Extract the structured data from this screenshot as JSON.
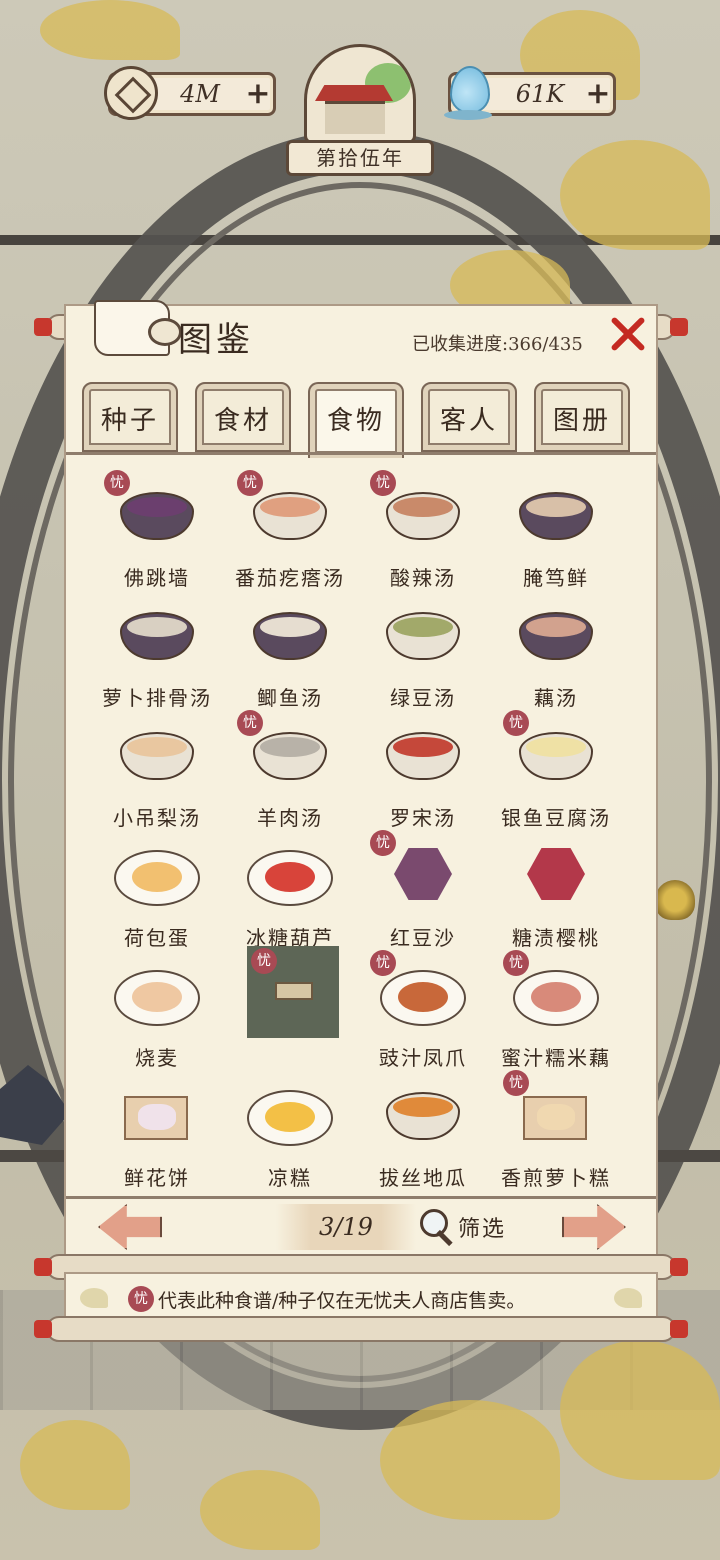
{
  "currencies": {
    "coins": {
      "icon": "coin-icon",
      "value": "4M",
      "plus": "+"
    },
    "water": {
      "icon": "water-drop-icon",
      "value": "61K",
      "plus": "+"
    }
  },
  "year_banner": "第拾伍年",
  "panel": {
    "title": "图鉴",
    "progress": "已收集进度:366/435",
    "close_icon": "close-icon"
  },
  "tabs": [
    {
      "label": "种子",
      "active": false
    },
    {
      "label": "食材",
      "active": false
    },
    {
      "label": "食物",
      "active": true
    },
    {
      "label": "客人",
      "active": false
    },
    {
      "label": "图册",
      "active": false
    }
  ],
  "shop_tag": "忧",
  "items": [
    {
      "name": "佛跳墙",
      "shop_only": true,
      "icon": "clay-pot-dish-icon",
      "color": "#6b3f6e"
    },
    {
      "name": "番茄疙瘩汤",
      "shop_only": true,
      "icon": "tomato-soup-bowl-icon",
      "color": "#e0a080"
    },
    {
      "name": "酸辣汤",
      "shop_only": true,
      "icon": "hot-sour-soup-bowl-icon",
      "color": "#c98a6a"
    },
    {
      "name": "腌笃鲜",
      "shop_only": false,
      "icon": "clay-pot-dish-icon",
      "color": "#d8c0a8"
    },
    {
      "name": "萝卜排骨汤",
      "shop_only": false,
      "icon": "clay-pot-dish-icon",
      "color": "#d9d0c2"
    },
    {
      "name": "鲫鱼汤",
      "shop_only": false,
      "icon": "clay-pot-dish-icon",
      "color": "#e6ddd0"
    },
    {
      "name": "绿豆汤",
      "shop_only": false,
      "icon": "mung-bean-soup-bowl-icon",
      "color": "#a2a96a"
    },
    {
      "name": "藕汤",
      "shop_only": false,
      "icon": "clay-pot-dish-icon",
      "color": "#d2a28e"
    },
    {
      "name": "小吊梨汤",
      "shop_only": false,
      "icon": "pear-soup-bowl-icon",
      "color": "#e9c7a0"
    },
    {
      "name": "羊肉汤",
      "shop_only": true,
      "icon": "mutton-soup-bowl-icon",
      "color": "#b8b2a8"
    },
    {
      "name": "罗宋汤",
      "shop_only": false,
      "icon": "borscht-bowl-icon",
      "color": "#c5483a"
    },
    {
      "name": "银鱼豆腐汤",
      "shop_only": true,
      "icon": "tofu-soup-bowl-icon",
      "color": "#efe1a5"
    },
    {
      "name": "荷包蛋",
      "shop_only": false,
      "icon": "fried-egg-plate-icon",
      "color": "#f2c070"
    },
    {
      "name": "冰糖葫芦",
      "shop_only": false,
      "icon": "candied-hawthorn-plate-icon",
      "color": "#d8443a"
    },
    {
      "name": "红豆沙",
      "shop_only": true,
      "icon": "red-bean-dessert-icon",
      "color": "#7a4a6e"
    },
    {
      "name": "糖渍樱桃",
      "shop_only": false,
      "icon": "candied-cherry-icon",
      "color": "#b3384a"
    },
    {
      "name": "烧麦",
      "shop_only": false,
      "icon": "steamer-basket-icon",
      "color": "#efc8a2"
    },
    {
      "name": "",
      "shop_only": true,
      "icon": "locked-item-icon",
      "color": "#5d6656"
    },
    {
      "name": "豉汁凤爪",
      "shop_only": true,
      "icon": "chicken-feet-plate-icon",
      "color": "#c8683a"
    },
    {
      "name": "蜜汁糯米藕",
      "shop_only": true,
      "icon": "honey-lotus-root-plate-icon",
      "color": "#d88a7a"
    },
    {
      "name": "鲜花饼",
      "shop_only": false,
      "icon": "flower-pastry-tray-icon",
      "color": "#f0e2ea"
    },
    {
      "name": "凉糕",
      "shop_only": false,
      "icon": "cold-cake-plate-icon",
      "color": "#f3c046"
    },
    {
      "name": "拔丝地瓜",
      "shop_only": false,
      "icon": "candied-sweet-potato-tray-icon",
      "color": "#e08a3a"
    },
    {
      "name": "香煎萝卜糕",
      "shop_only": true,
      "icon": "radish-cake-tray-icon",
      "color": "#f0d8b0"
    }
  ],
  "pagination": {
    "prev_icon": "arrow-left-icon",
    "page": "3/19",
    "next_icon": "arrow-right-icon",
    "filter_icon": "magnifier-icon",
    "filter_label": "筛选"
  },
  "note": {
    "tag": "忧",
    "text": "代表此种食谱/种子仅在无忧夫人商店售卖。"
  }
}
